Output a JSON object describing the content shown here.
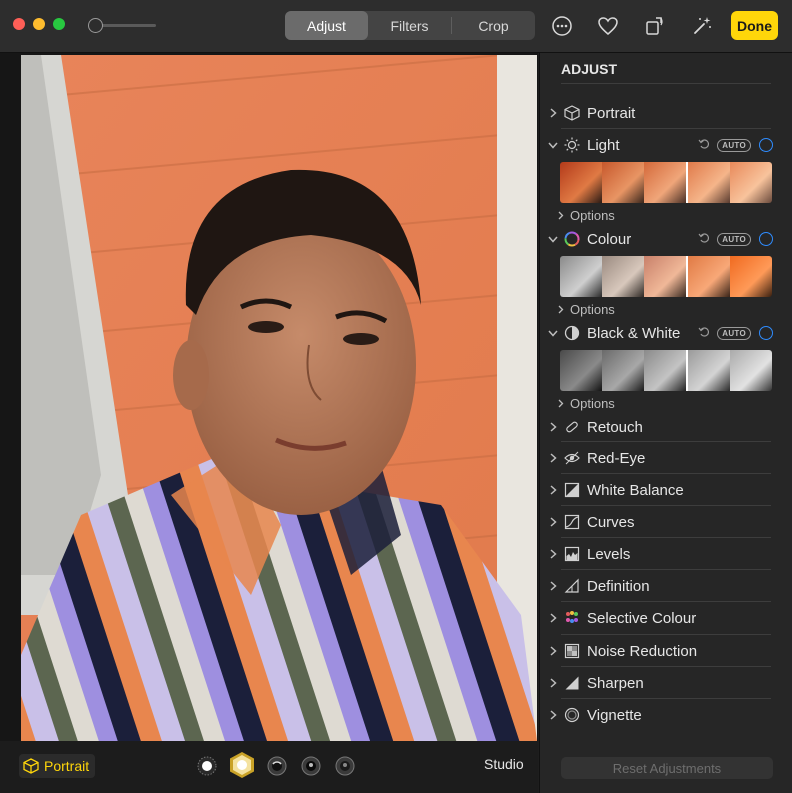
{
  "toolbar": {
    "tabs": [
      {
        "label": "Adjust",
        "active": true
      },
      {
        "label": "Filters",
        "active": false
      },
      {
        "label": "Crop",
        "active": false
      }
    ],
    "icons": [
      "more-icon",
      "heart-icon",
      "rotate-icon",
      "magic-wand-icon"
    ],
    "done_label": "Done"
  },
  "bottom_bar": {
    "portrait_label": "Portrait",
    "lighting_options": [
      "natural-light",
      "studio-light",
      "contour-light",
      "stage-light",
      "stage-light-mono"
    ],
    "current_lighting": "Studio"
  },
  "panel": {
    "title": "ADJUST",
    "portrait_label": "Portrait",
    "light": {
      "label": "Light",
      "auto": "AUTO",
      "options": "Options"
    },
    "colour": {
      "label": "Colour",
      "auto": "AUTO",
      "options": "Options"
    },
    "bw": {
      "label": "Black & White",
      "auto": "AUTO",
      "options": "Options"
    },
    "tools": [
      {
        "label": "Retouch",
        "icon": "bandage-icon"
      },
      {
        "label": "Red-Eye",
        "icon": "eye-icon"
      },
      {
        "label": "White Balance",
        "icon": "white-balance-icon"
      },
      {
        "label": "Curves",
        "icon": "curves-icon"
      },
      {
        "label": "Levels",
        "icon": "levels-icon"
      },
      {
        "label": "Definition",
        "icon": "definition-icon"
      },
      {
        "label": "Selective Colour",
        "icon": "selective-colour-icon"
      },
      {
        "label": "Noise Reduction",
        "icon": "noise-reduction-icon"
      },
      {
        "label": "Sharpen",
        "icon": "sharpen-icon"
      },
      {
        "label": "Vignette",
        "icon": "vignette-icon"
      }
    ],
    "reset_label": "Reset Adjustments"
  },
  "colors": {
    "accent_yellow": "#ffd60a",
    "toggle_blue": "#2f8cff",
    "wall_orange": "#e9865a"
  }
}
